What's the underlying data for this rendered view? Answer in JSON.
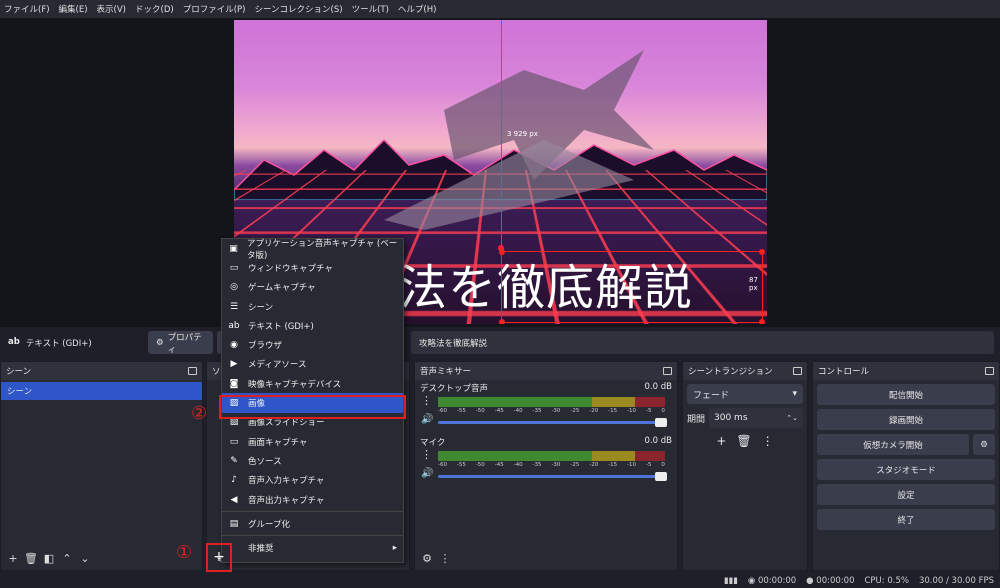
{
  "menu": [
    "ファイル(F)",
    "編集(E)",
    "表示(V)",
    "ドック(D)",
    "プロファイル(P)",
    "シーンコレクション(S)",
    "ツール(T)",
    "ヘルプ(H)"
  ],
  "preview": {
    "overlay_text": "法を徹底解説",
    "px_top": "3 929 px",
    "px_right": "87 px"
  },
  "toolbar": {
    "source_name": "テキスト (GDI+)",
    "properties": "プロパティ",
    "text_value": "攻略法を徹底解説"
  },
  "scenes": {
    "title": "シーン",
    "item": "シーン"
  },
  "sources": {
    "title": "ソ"
  },
  "mixer": {
    "title": "音声ミキサー",
    "channels": [
      {
        "name": "デスクトップ音声",
        "db": "0.0 dB"
      },
      {
        "name": "マイク",
        "db": "0.0 dB"
      }
    ],
    "ticks": [
      "-60",
      "-55",
      "-50",
      "-45",
      "-40",
      "-35",
      "-30",
      "-25",
      "-20",
      "-15",
      "-10",
      "-5",
      "0"
    ]
  },
  "transition": {
    "title": "シーントランジション",
    "select": "フェード",
    "duration_label": "期間",
    "duration": "300 ms"
  },
  "controls": {
    "title": "コントロール",
    "buttons": [
      "配信開始",
      "録画開始",
      "仮想カメラ開始",
      "スタジオモード",
      "設定",
      "終了"
    ]
  },
  "menu_popup": {
    "items": [
      {
        "icon": "app-audio-icon",
        "glyph": "▣",
        "label": "アプリケーション音声キャプチャ (ベータ版)"
      },
      {
        "icon": "window-icon",
        "glyph": "▭",
        "label": "ウィンドウキャプチャ"
      },
      {
        "icon": "gamepad-icon",
        "glyph": "◎",
        "label": "ゲームキャプチャ"
      },
      {
        "icon": "list-icon",
        "glyph": "☰",
        "label": "シーン"
      },
      {
        "icon": "text-icon",
        "glyph": "ab",
        "label": "テキスト (GDI+)"
      },
      {
        "icon": "globe-icon",
        "glyph": "◉",
        "label": "ブラウザ"
      },
      {
        "icon": "play-icon",
        "glyph": "▶",
        "label": "メディアソース"
      },
      {
        "icon": "camera-icon",
        "glyph": "◙",
        "label": "映像キャプチャデバイス"
      },
      {
        "icon": "image-icon",
        "glyph": "▨",
        "label": "画像"
      },
      {
        "icon": "slideshow-icon",
        "glyph": "▧",
        "label": "画像スライドショー"
      },
      {
        "icon": "monitor-icon",
        "glyph": "▭",
        "label": "画面キャプチャ"
      },
      {
        "icon": "brush-icon",
        "glyph": "✎",
        "label": "色ソース"
      },
      {
        "icon": "mic-icon",
        "glyph": "♪",
        "label": "音声入力キャプチャ"
      },
      {
        "icon": "speaker-icon",
        "glyph": "◀",
        "label": "音声出力キャプチャ"
      },
      {
        "icon": "folder-icon",
        "glyph": "▤",
        "label": "グループ化"
      },
      {
        "icon": "",
        "glyph": "",
        "label": "非推奨"
      }
    ]
  },
  "annotations": {
    "one": "①",
    "two": "②"
  },
  "status": {
    "time1": "00:00:00",
    "time2": "00:00:00",
    "cpu": "CPU: 0.5%",
    "fps": "30.00 / 30.00 FPS"
  },
  "colors": {
    "accent": "#2f56c9",
    "annotation": "#e02020"
  }
}
